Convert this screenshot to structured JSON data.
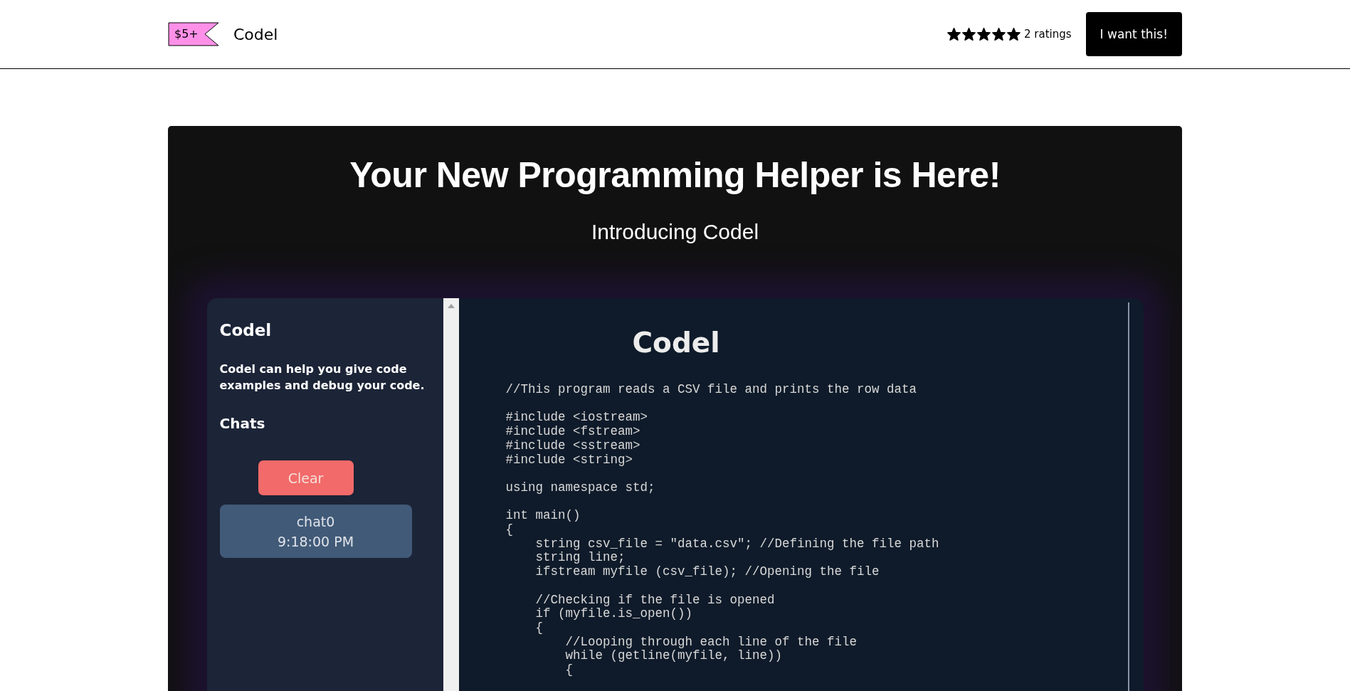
{
  "header": {
    "price": "$5+",
    "product_name": "Codel",
    "stars": 5,
    "ratings": "2 ratings",
    "buy_button": "I want this!"
  },
  "hero": {
    "title": "Your New Programming Helper is Here!",
    "subtitle": "Introducing Codel"
  },
  "app_preview": {
    "sidebar": {
      "title": "Codel",
      "description": "Codel can help you give code examples and debug your code.",
      "chats_heading": "Chats",
      "clear_button": "Clear",
      "chats": [
        {
          "name": "chat0",
          "time": "9:18:00 PM"
        }
      ]
    },
    "main": {
      "title": "Codel",
      "code": "//This program reads a CSV file and prints the row data\n\n#include <iostream>\n#include <fstream>\n#include <sstream>\n#include <string>\n\nusing namespace std;\n\nint main()\n{\n    string csv_file = \"data.csv\"; //Defining the file path\n    string line;\n    ifstream myfile (csv_file); //Opening the file\n\n    //Checking if the file is opened\n    if (myfile.is_open())\n    {\n        //Looping through each line of the file\n        while (getline(myfile, line))\n        {"
    }
  }
}
